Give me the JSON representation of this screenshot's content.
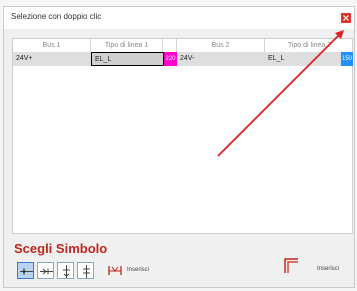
{
  "dialog": {
    "title": "Selezione con doppio clic"
  },
  "grid": {
    "columns": [
      "Bus 1",
      "Tipo di linea 1",
      "",
      "Bus 2",
      "Tipo di linea 2"
    ],
    "rows": [
      {
        "bus1": "24V+",
        "type1": "EL_L",
        "color1_label": "220",
        "color1": "#ff00cc",
        "bus2": "24V-",
        "type2": "EL_L",
        "color2_label": "150",
        "color2": "#1e90ff"
      }
    ]
  },
  "symbol": {
    "heading": "Scegli Simbolo",
    "insert1_label": "Inserisci",
    "insert2_label": "Inserisci"
  },
  "colors": {
    "accent_red": "#c1271c",
    "arrow_red": "#e02020",
    "selected_blue": "#b8d3f3"
  }
}
